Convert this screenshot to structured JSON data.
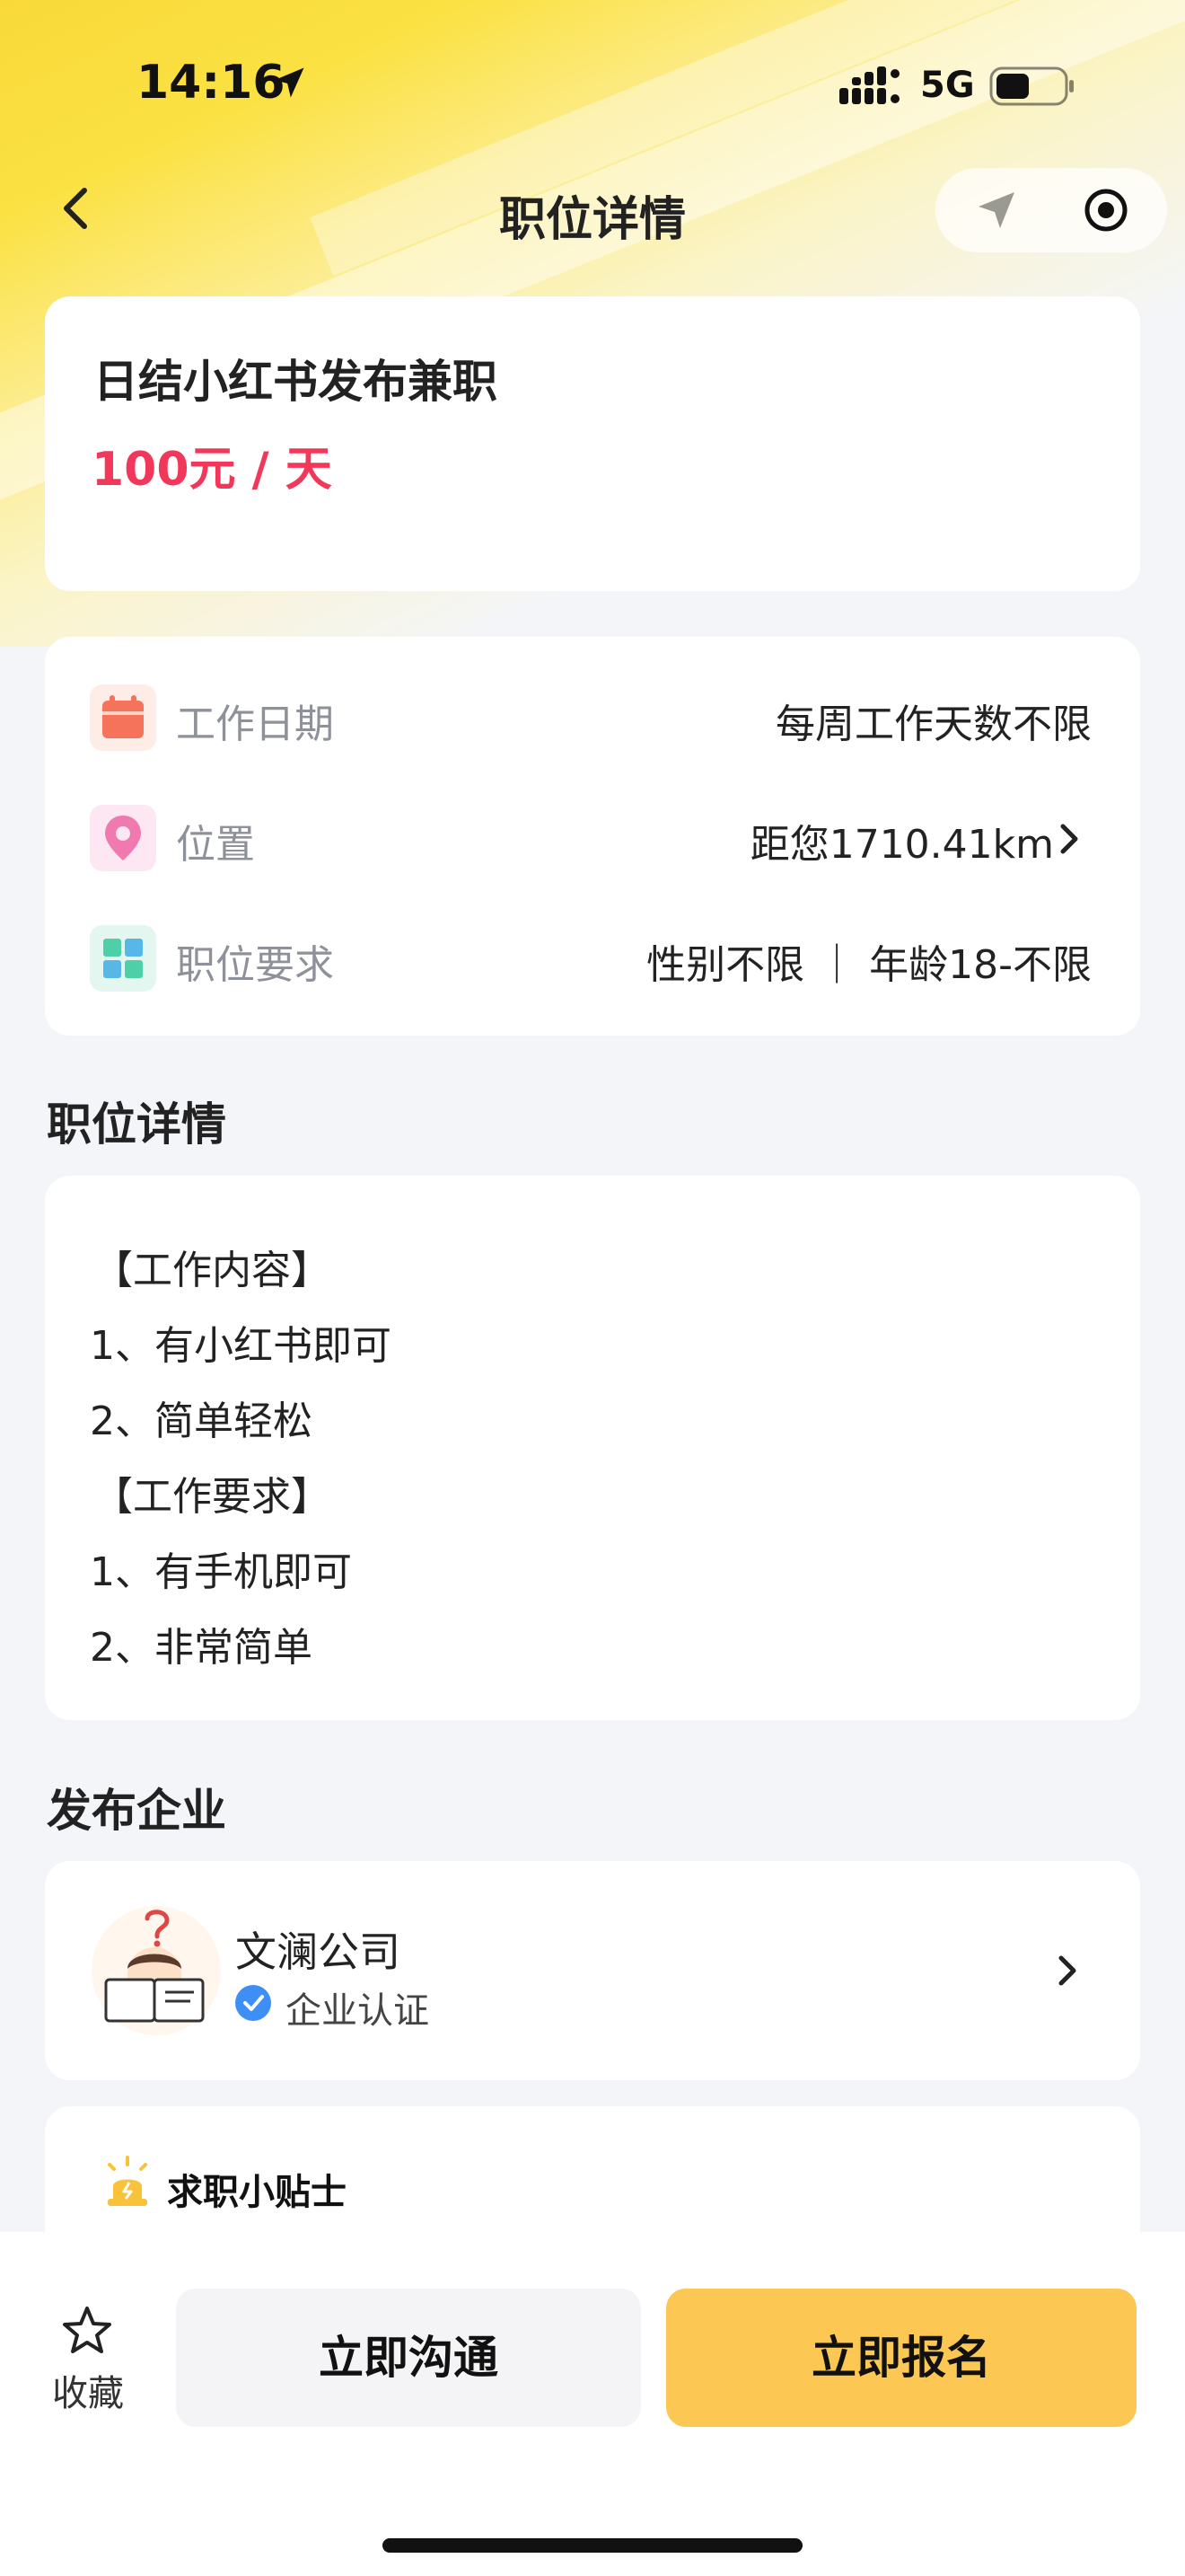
{
  "status_bar": {
    "time": "14:16",
    "network": "5G"
  },
  "nav": {
    "title": "职位详情"
  },
  "job": {
    "title": "日结小红书发布兼职",
    "salary": "100元 / 天"
  },
  "info": [
    {
      "label": "工作日期",
      "value": "每周工作天数不限",
      "icon": "calendar-icon",
      "color": "#f5735a"
    },
    {
      "label": "位置",
      "value": "距您1710.41km",
      "icon": "location-pin-icon",
      "color": "#f07ab0"
    },
    {
      "label": "职位要求",
      "value": "性别不限 ｜ 年龄18-不限",
      "icon": "grid-icon",
      "color": "#4fcfa8"
    }
  ],
  "details": {
    "heading": "职位详情",
    "lines": [
      "【工作内容】",
      "1、有小红书即可",
      "2、简单轻松",
      "【工作要求】",
      "1、有手机即可",
      "2、非常简单"
    ]
  },
  "company": {
    "heading": "发布企业",
    "name": "文澜公司",
    "verified_label": "企业认证"
  },
  "tips": {
    "title": "求职小贴士"
  },
  "bottom": {
    "favorite_label": "收藏",
    "chat_label": "立即沟通",
    "apply_label": "立即报名"
  },
  "colors": {
    "accent": "#fcc752",
    "salary": "#f2385a",
    "verify": "#3d8ff6"
  }
}
